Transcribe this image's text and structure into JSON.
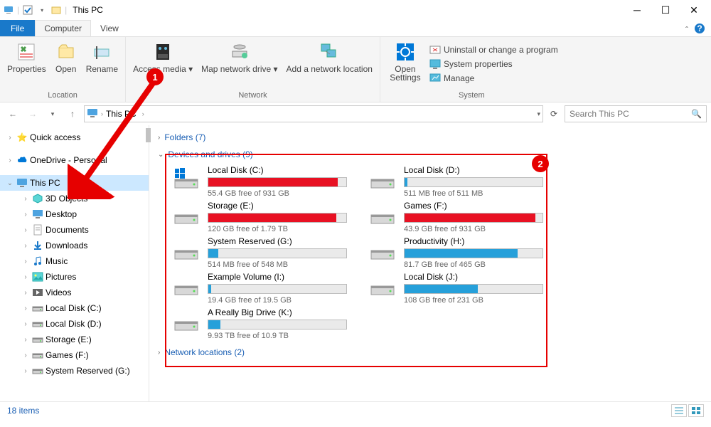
{
  "window": {
    "title": "This PC"
  },
  "tabs": {
    "file": "File",
    "computer": "Computer",
    "view": "View"
  },
  "ribbon": {
    "location": {
      "properties": "Properties",
      "open": "Open",
      "rename": "Rename",
      "label": "Location"
    },
    "network": {
      "access_media": "Access media ▾",
      "map_drive": "Map network drive ▾",
      "add_loc": "Add a network location",
      "label": "Network"
    },
    "open_settings": "Open Settings",
    "system": {
      "uninstall": "Uninstall or change a program",
      "sysprops": "System properties",
      "manage": "Manage",
      "label": "System"
    }
  },
  "breadcrumb": {
    "root": "This PC"
  },
  "search": {
    "placeholder": "Search This PC"
  },
  "tree": {
    "quick": "Quick access",
    "onedrive": "OneDrive - Personal",
    "thispc": "This PC",
    "sub": [
      "3D Objects",
      "Desktop",
      "Documents",
      "Downloads",
      "Music",
      "Pictures",
      "Videos",
      "Local Disk (C:)",
      "Local Disk (D:)",
      "Storage (E:)",
      "Games (F:)",
      "System Reserved (G:)"
    ]
  },
  "sections": {
    "folders": "Folders (7)",
    "devices": "Devices and drives (9)",
    "netloc": "Network locations (2)"
  },
  "drives": [
    {
      "name": "Local Disk (C:)",
      "free": "55.4 GB free of 931 GB",
      "pct": 94,
      "color": "#e81123"
    },
    {
      "name": "Local Disk (D:)",
      "free": "511 MB free of 511 MB",
      "pct": 2,
      "color": "#26a0da"
    },
    {
      "name": "Storage (E:)",
      "free": "120 GB free of 1.79 TB",
      "pct": 93,
      "color": "#e81123"
    },
    {
      "name": "Games (F:)",
      "free": "43.9 GB free of 931 GB",
      "pct": 95,
      "color": "#e81123"
    },
    {
      "name": "System Reserved (G:)",
      "free": "514 MB free of 548 MB",
      "pct": 7,
      "color": "#26a0da"
    },
    {
      "name": "Productivity (H:)",
      "free": "81.7 GB free of 465 GB",
      "pct": 82,
      "color": "#26a0da"
    },
    {
      "name": "Example Volume (I:)",
      "free": "19.4 GB free of 19.5 GB",
      "pct": 2,
      "color": "#26a0da"
    },
    {
      "name": "Local Disk (J:)",
      "free": "108 GB free of 231 GB",
      "pct": 53,
      "color": "#26a0da"
    },
    {
      "name": "A Really Big Drive (K:)",
      "free": "9.93 TB free of 10.9 TB",
      "pct": 9,
      "color": "#26a0da"
    }
  ],
  "status": {
    "items": "18 items"
  },
  "annotations": {
    "badge1": "1",
    "badge2": "2"
  }
}
